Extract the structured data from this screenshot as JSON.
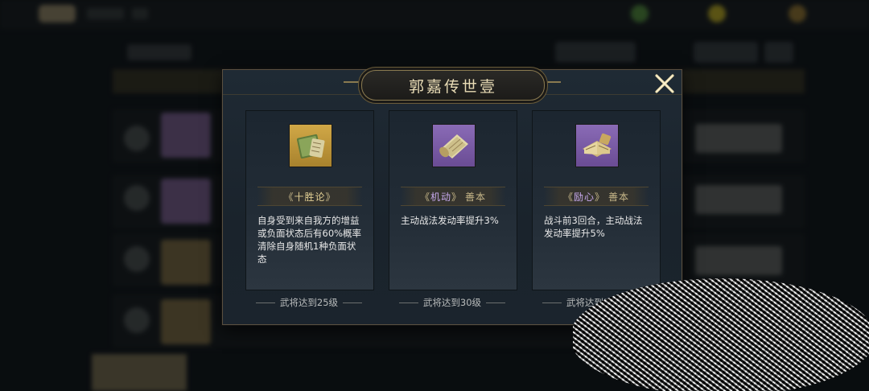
{
  "modal": {
    "title": "郭嘉传世壹",
    "close_icon": "close-x-icon"
  },
  "cards": [
    {
      "icon": "book-scroll-gold-icon",
      "rarity_color": "#c9a33e",
      "name_open": "《",
      "name": "十胜论",
      "name_close": "》",
      "suffix": "",
      "description": "自身受到来自我方的增益或负面状态后有60%概率清除自身随机1种负面状态",
      "requirement": "武将达到25级"
    },
    {
      "icon": "scroll-purple-icon",
      "rarity_color": "#7d5fae",
      "name_open": "《",
      "name": "机动",
      "name_close": "》",
      "suffix": "善本",
      "description": "主动战法发动率提升3%",
      "requirement": "武将达到30级"
    },
    {
      "icon": "book-purple-icon",
      "rarity_color": "#7d5fae",
      "name_open": "《",
      "name": "励心",
      "name_close": "》",
      "suffix": "善本",
      "description": "战斗前3回合，主动战法发动率提升5%",
      "requirement": "武将达到35级"
    }
  ]
}
